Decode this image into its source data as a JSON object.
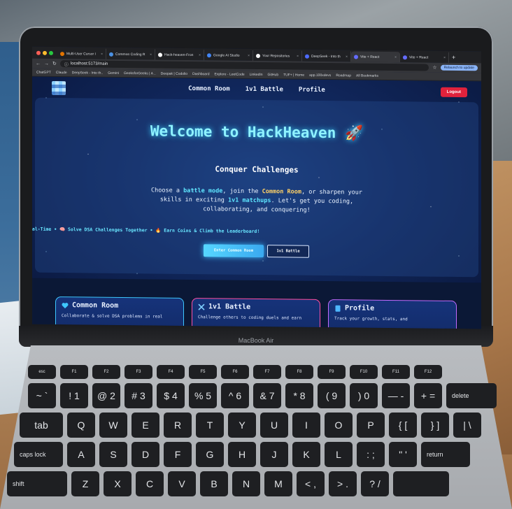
{
  "browser": {
    "tabs": [
      {
        "label": "Multi-User Cursor I",
        "color": "#e37400"
      },
      {
        "label": "Common Coding R",
        "color": "#4a90e2"
      },
      {
        "label": "Hack-heaven-Fron",
        "color": "#ffffff"
      },
      {
        "label": "Google AI Studio",
        "color": "#4285f4"
      },
      {
        "label": "Your Repositories",
        "color": "#ffffff"
      },
      {
        "label": "DeepSeek - Into th",
        "color": "#4d6bfe"
      },
      {
        "label": "Vite + React",
        "color": "#646cff",
        "active": true
      },
      {
        "label": "Vite + React",
        "color": "#646cff"
      }
    ],
    "url": "localhost:5173/main",
    "relaunch_label": "Relaunch to update",
    "bookmarks": [
      "ChatGPT",
      "Claude",
      "DeepSeek - Into th..",
      "Gemini",
      "GeeksforGeeks | A ..",
      "Deepak | Codolio",
      "Dashboard",
      "Explore - LeetCode",
      "LinkedIn",
      "GitHub",
      "TUF+ | Home",
      "app.100xdevs",
      "Roadmap",
      "All Bookmarks"
    ]
  },
  "app": {
    "nav": [
      "Common Room",
      "1v1 Battle",
      "Profile"
    ],
    "logout_label": "Logout",
    "hero": {
      "title": "Welcome to HackHeaven 🚀",
      "subtitle": "Conquer Challenges",
      "desc": {
        "p1": "Choose a ",
        "h1": "battle mode",
        "p2": ", join the ",
        "h2": "Common Room",
        "p3": ", or sharpen your skills in exciting ",
        "h3": "1v1 matchups",
        "p4": ". Let's get you coding, collaborating, and conquering!"
      },
      "ticker": "eal-Time • 🧠 Solve DSA Challenges Together • 🔥 Earn Coins & Climb the Leaderboard!",
      "primary_label": "Enter Common Room",
      "secondary_label": "1v1 Battle"
    },
    "cards": [
      {
        "title": "Common Room",
        "desc": "Collaborate & solve DSA problems in real",
        "icon": "heart-icon",
        "color": "#3ec7ff"
      },
      {
        "title": "1v1 Battle",
        "desc": "Challenge others to coding duels and earn",
        "icon": "crossed-swords-icon",
        "color": "#ff4fa3"
      },
      {
        "title": "Profile",
        "desc": "Track your growth, stats, and",
        "icon": "document-icon",
        "color": "#c36bff"
      }
    ]
  },
  "laptop": {
    "brand": "MacBook Air"
  },
  "keyboard": {
    "fn_row": [
      "esc",
      "F1",
      "F2",
      "F3",
      "F4",
      "F5",
      "F6",
      "F7",
      "F8",
      "F9",
      "F10",
      "F11",
      "F12"
    ],
    "num_row": [
      "~ `",
      "! 1",
      "@ 2",
      "# 3",
      "$ 4",
      "% 5",
      "^ 6",
      "& 7",
      "* 8",
      "( 9",
      ") 0",
      "— -",
      "+ =",
      "delete"
    ],
    "q_row": [
      "tab",
      "Q",
      "W",
      "E",
      "R",
      "T",
      "Y",
      "U",
      "I",
      "O",
      "P",
      "{ [",
      "} ]",
      "| \\"
    ],
    "a_row": [
      "caps lock",
      "A",
      "S",
      "D",
      "F",
      "G",
      "H",
      "J",
      "K",
      "L",
      ": ;",
      "\" '",
      "return"
    ],
    "z_row": [
      "shift",
      "Z",
      "X",
      "C",
      "V",
      "B",
      "N",
      "M",
      "< ,",
      "> .",
      "? /",
      ""
    ]
  }
}
